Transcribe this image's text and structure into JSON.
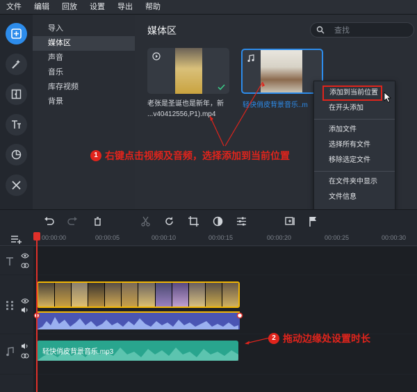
{
  "menu": [
    "文件",
    "编辑",
    "回放",
    "设置",
    "导出",
    "帮助"
  ],
  "categories": [
    "导入",
    "媒体区",
    "声音",
    "音乐",
    "库存视频",
    "背景"
  ],
  "media": {
    "title": "媒体区",
    "search_placeholder": "查找",
    "item1_caption_line1": "老张是圣诞也是新年，新",
    "item1_caption_line2": "...v40412556,P1).mp4",
    "item2_caption": "轻快俏皮背景音乐..m"
  },
  "context_menu": {
    "add_current": "添加到当前位置",
    "add_start": "在开头添加",
    "add_file": "添加文件",
    "select_all": "选择所有文件",
    "remove": "移除选定文件",
    "show_folder": "在文件夹中显示",
    "file_info": "文件信息"
  },
  "callouts": {
    "num1": "1",
    "text1": "右键点击视频及音频，选择添加到当前位置",
    "num2": "2",
    "text2": "拖动边缘处设置时长"
  },
  "ruler": [
    "00:00:00",
    "00:00:05",
    "00:00:10",
    "00:00:15",
    "00:00:20",
    "00:00:25",
    "00:00:30"
  ],
  "audio_clip_label": "轻快俏皮背景音乐.mp3",
  "colors": {
    "accent": "#2d8ceb",
    "callout": "#e0241c",
    "video_border": "#f2b705",
    "audio_clip": "#29a58e",
    "video_audio": "#4a55b3"
  }
}
